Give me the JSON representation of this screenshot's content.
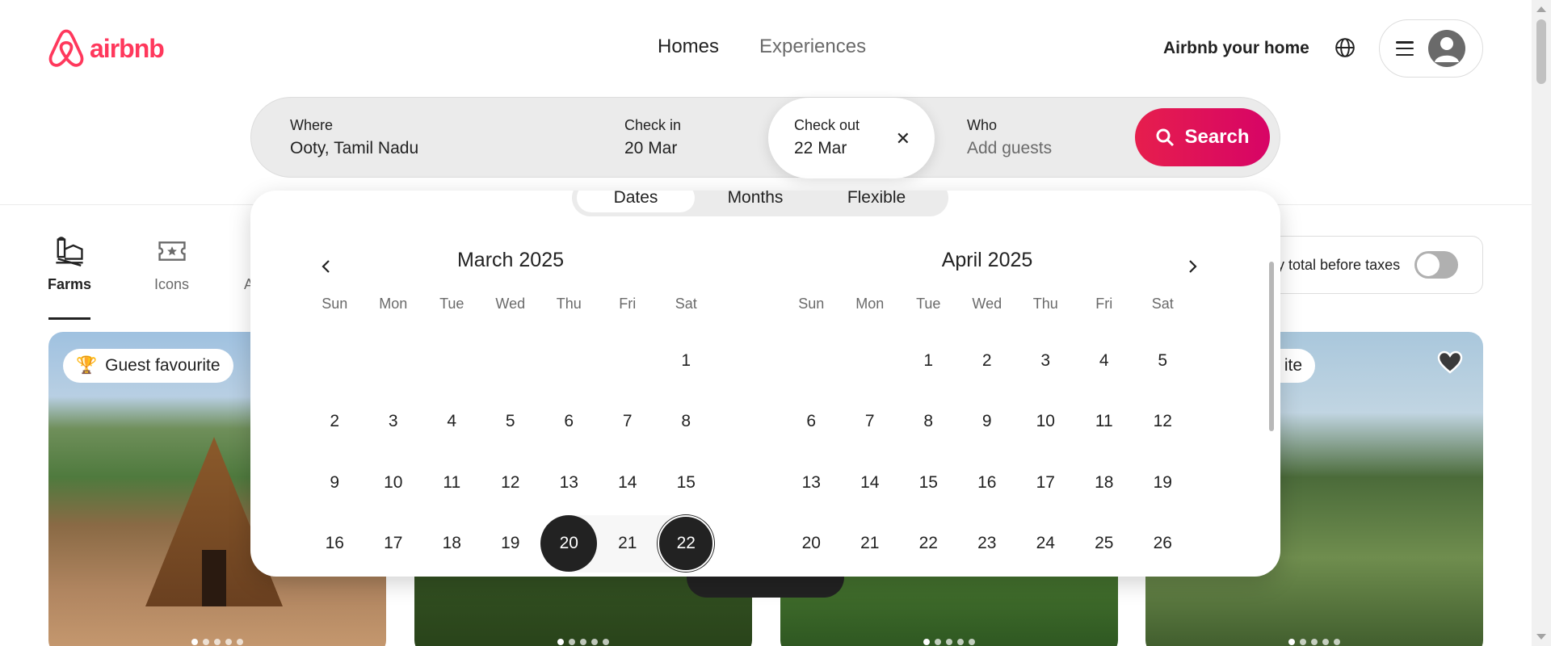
{
  "header": {
    "logo_text": "airbnb",
    "brand_color": "#ff385c",
    "nav_tabs": [
      {
        "label": "Homes",
        "active": true
      },
      {
        "label": "Experiences",
        "active": false
      }
    ],
    "host_link": "Airbnb your home",
    "icons": {
      "globe": "globe-icon",
      "menu": "hamburger-menu-icon",
      "avatar": "user-avatar-icon"
    }
  },
  "search": {
    "where_label": "Where",
    "where_value": "Ooty, Tamil Nadu",
    "checkin_label": "Check in",
    "checkin_value": "20 Mar",
    "checkout_label": "Check out",
    "checkout_value": "22 Mar",
    "clear_icon": "close-icon",
    "who_label": "Who",
    "who_placeholder": "Add guests",
    "button_label": "Search",
    "button_color": "#e61e4d"
  },
  "calendar": {
    "mode_tabs": [
      {
        "label": "Dates",
        "active": true
      },
      {
        "label": "Months",
        "active": false
      },
      {
        "label": "Flexible",
        "active": false
      }
    ],
    "weekdays": [
      "Sun",
      "Mon",
      "Tue",
      "Wed",
      "Thu",
      "Fri",
      "Sat"
    ],
    "months": [
      {
        "title": "March 2025",
        "rows": [
          [
            "",
            "",
            "",
            "",
            "",
            "",
            "1"
          ],
          [
            "2",
            "3",
            "4",
            "5",
            "6",
            "7",
            "8"
          ],
          [
            "9",
            "10",
            "11",
            "12",
            "13",
            "14",
            "15"
          ],
          [
            "16",
            "17",
            "18",
            "19",
            "20",
            "21",
            "22"
          ]
        ]
      },
      {
        "title": "April 2025",
        "rows": [
          [
            "",
            "",
            "1",
            "2",
            "3",
            "4",
            "5"
          ],
          [
            "6",
            "7",
            "8",
            "9",
            "10",
            "11",
            "12"
          ],
          [
            "13",
            "14",
            "15",
            "16",
            "17",
            "18",
            "19"
          ],
          [
            "20",
            "21",
            "22",
            "23",
            "24",
            "25",
            "26"
          ]
        ]
      }
    ],
    "selected_start": "20",
    "selected_end": "22"
  },
  "categories": [
    {
      "label": "Farms",
      "icon": "farm-icon",
      "active": true
    },
    {
      "label": "Icons",
      "icon": "ticket-star-icon",
      "active": false
    }
  ],
  "category_partial": "A",
  "total_toggle": {
    "label": "y total before taxes",
    "on": false
  },
  "listings": [
    {
      "badge": "Guest favourite",
      "badge_icon": "trophy-icon"
    },
    {
      "badge": ""
    },
    {
      "badge": ""
    },
    {
      "badge": "ite",
      "favourited": true
    }
  ]
}
